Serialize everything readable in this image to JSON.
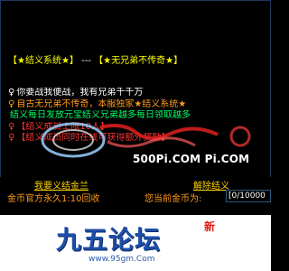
{
  "header": {
    "left": "【★结义系统★】",
    "sep": "---",
    "right": "【★无兄弟不传奇★】"
  },
  "chat": [
    {
      "sym": "♀",
      "text": "你要战我便战，我有兄弟千千万",
      "color": "white"
    },
    {
      "sym": "♀",
      "text": "自古无兄弟不传奇，本服独家★结义系统★",
      "color": "orange"
    },
    {
      "sym": "",
      "text": "结义每日发放元宝结义兄弟越多每日领取越多",
      "color": "green"
    },
    {
      "sym": "♀",
      "text": "【结义成员上限10人】",
      "color": "red"
    },
    {
      "sym": "♀",
      "text": "【结义成员同时在线可获得额外奖励】",
      "color": "red"
    }
  ],
  "watermark": {
    "url": "500Pi.COM Pi.COM"
  },
  "lower": {
    "left_link": "我要义结金兰",
    "right_link": "解除结义",
    "left_label": "金币官方永久1:10回收",
    "right_label": "您当前金币为:",
    "input_value": "[0/10000"
  },
  "logo": {
    "text": "九五论坛",
    "url": "www.95gm.Com",
    "badge": "新"
  }
}
